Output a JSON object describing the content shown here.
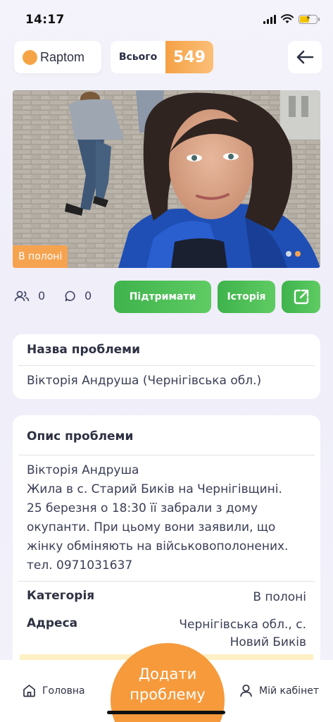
{
  "status_bar": {
    "time": "14:17"
  },
  "header": {
    "logo_text": "Raptom",
    "total_label": "Всього",
    "total_count": "549"
  },
  "photo": {
    "badge": "В полоні",
    "pagination_total": 2,
    "pagination_active": 2
  },
  "actions": {
    "supporters_count": "0",
    "comments_count": "0",
    "support_label": "Підтримати",
    "history_label": "Історія"
  },
  "problem_name": {
    "title": "Назва проблеми",
    "value": "Вікторія Андруша (Чернігівська обл.)"
  },
  "problem_description": {
    "title": "Опис проблеми",
    "lines": [
      "Вікторія Андруша",
      "Жила в с. Старий Биків на Чернігівщині.",
      "25 березня о 18:30 її забрали з дому",
      "окупанти. При цьому вони заявили, що",
      "жінку обміняють на військовополонених.",
      "тел. 0971031637"
    ]
  },
  "details": {
    "category_label": "Категорія",
    "category_value": "В полоні",
    "address_label": "Адреса",
    "address_line1": "Чернігівська обл., с.",
    "address_line2": "Новий Биків"
  },
  "bottom_nav": {
    "home_label": "Головна",
    "add_line1": "Додати",
    "add_line2": "проблему",
    "cabinet_label": "Мій кабінет"
  },
  "colors": {
    "accent_orange": "#f69a3c",
    "green": "#4cbf55",
    "text_dark": "#2d3142"
  }
}
